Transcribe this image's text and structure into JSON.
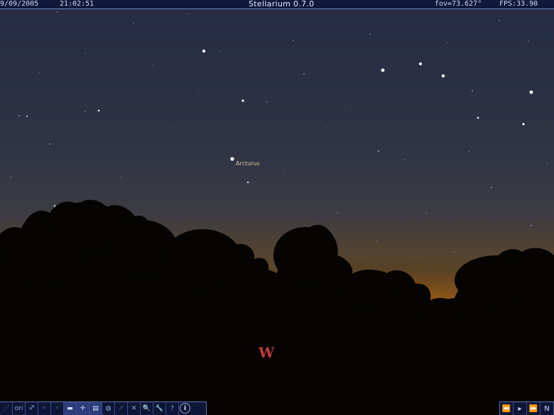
{
  "topbar": {
    "date": "9/09/2005",
    "time": "21:02:51",
    "title": "Stellarium 0.7.0",
    "fov": "fov=73.627°",
    "fps": "FPS:33.90"
  },
  "sky": {
    "star_label": "Arcturus",
    "cardinal": "W",
    "colors": {
      "sky_top": "#262c44",
      "sky_mid": "#3a3d4a",
      "horizon_glow": "#d27a12",
      "trees": "#050403",
      "cardinal": "#c03a3a"
    }
  },
  "toolbar": {
    "buttons": [
      {
        "icon": "constellation-lines-icon",
        "glyph": "⋰"
      },
      {
        "icon": "constellation-names-icon",
        "glyph": "ori"
      },
      {
        "icon": "constellation-art-icon",
        "glyph": "♐"
      },
      {
        "icon": "azimuth-grid-icon",
        "glyph": "◦"
      },
      {
        "icon": "equatorial-grid-icon",
        "glyph": "◦"
      },
      {
        "icon": "ground-icon",
        "glyph": "▬"
      },
      {
        "icon": "cardinal-points-icon",
        "glyph": "✛"
      },
      {
        "icon": "atmosphere-icon",
        "glyph": "▤"
      },
      {
        "icon": "nebula-icon",
        "glyph": "◍"
      },
      {
        "icon": "equatorial-mount-icon",
        "glyph": "⟋"
      },
      {
        "icon": "goto-icon",
        "glyph": "✕"
      },
      {
        "icon": "search-icon",
        "glyph": "🔍"
      },
      {
        "icon": "configuration-icon",
        "glyph": "🔧"
      },
      {
        "icon": "help-icon",
        "glyph": "?"
      },
      {
        "icon": "info-icon",
        "glyph": "i"
      }
    ]
  },
  "timebar": {
    "buttons": [
      {
        "icon": "rewind-icon",
        "glyph": "⏪"
      },
      {
        "icon": "play-icon",
        "glyph": "▸"
      },
      {
        "icon": "fast-forward-icon",
        "glyph": "⏩"
      },
      {
        "icon": "now-icon",
        "glyph": "N"
      }
    ]
  }
}
